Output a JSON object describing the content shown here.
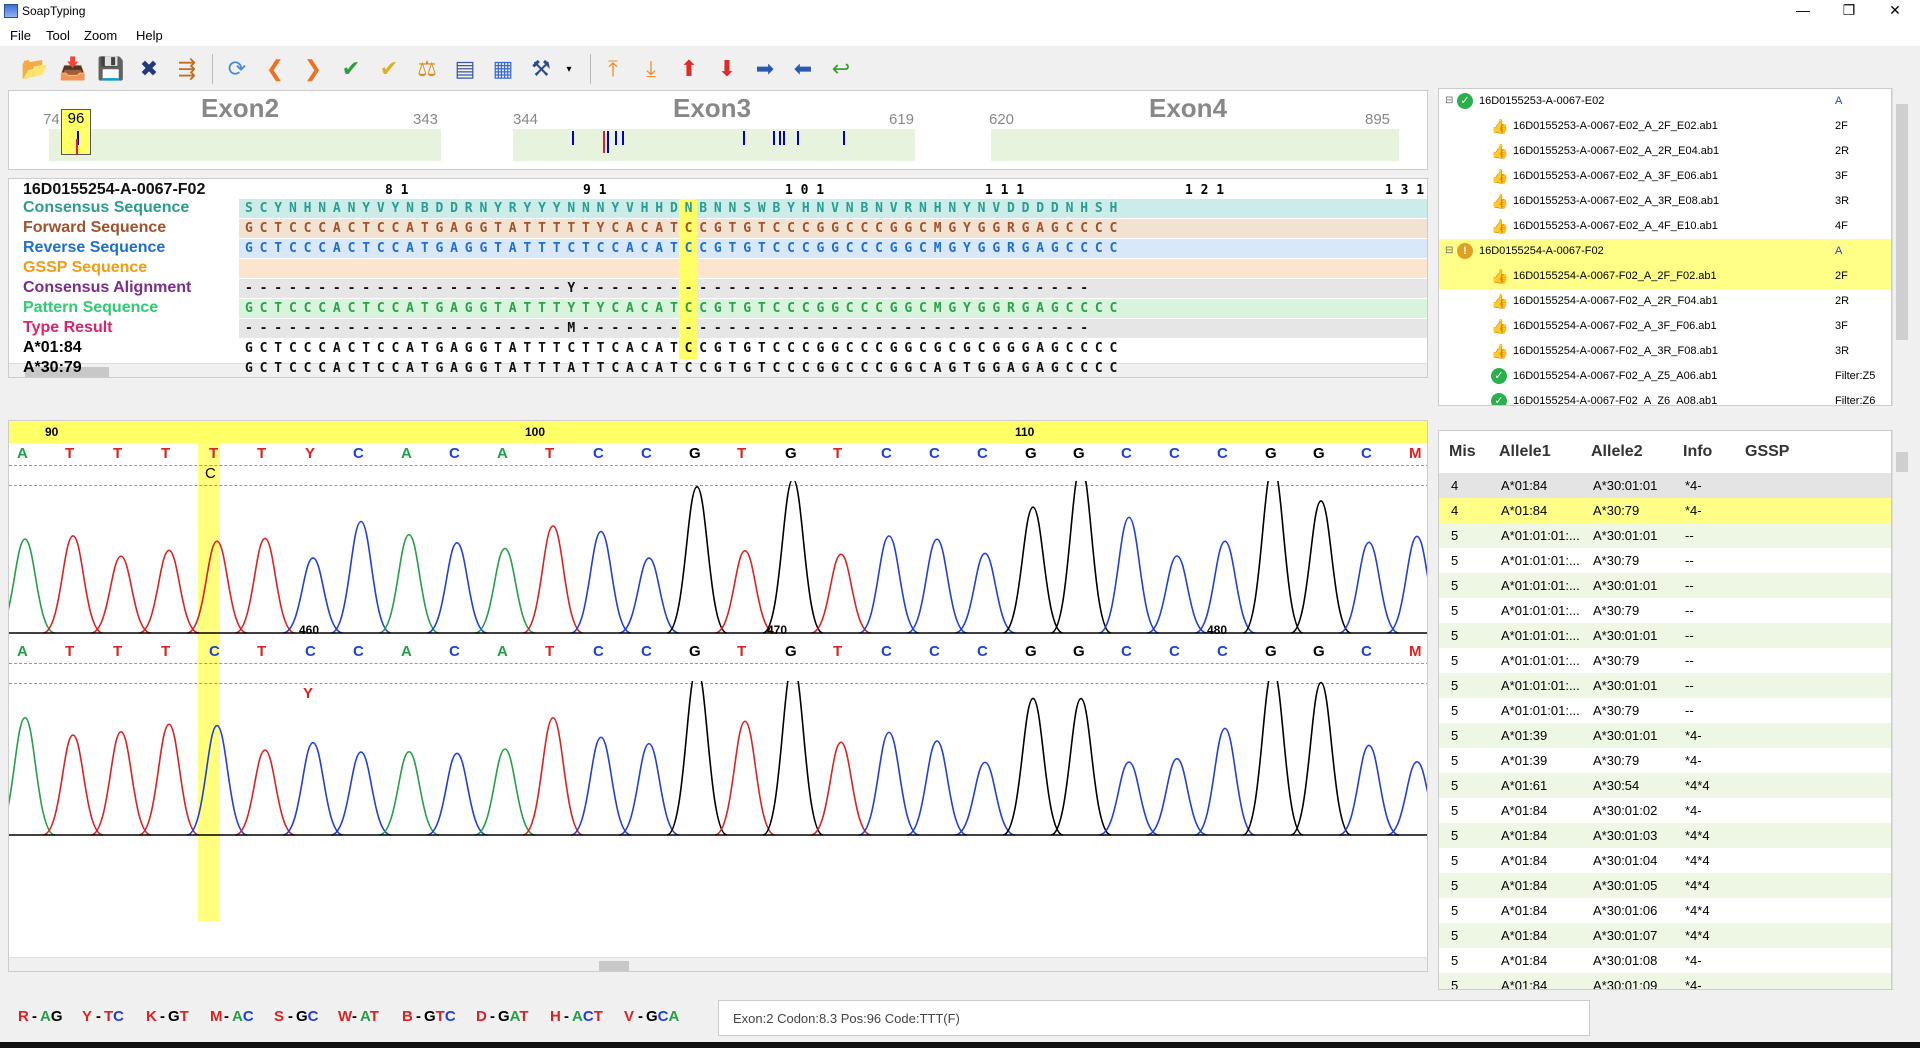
{
  "window": {
    "title": "SoapTyping",
    "minimize": "—",
    "restore": "❐",
    "close": "✕"
  },
  "menu": [
    "File",
    "Tool",
    "Zoom",
    "Help"
  ],
  "exon_map": {
    "exons": [
      {
        "label": "Exon2",
        "start": "74",
        "end": "343"
      },
      {
        "label": "Exon3",
        "start": "344",
        "end": "619"
      },
      {
        "label": "Exon4",
        "start": "620",
        "end": "895"
      }
    ],
    "position_marker": "96"
  },
  "seq_table": {
    "sample_id": "16D0155254-A-0067-F02",
    "codon_numbers": [
      "8 1",
      "9 1",
      "1 0 1",
      "1 1 1",
      "1 2 1",
      "1 3 1"
    ],
    "rows": [
      {
        "label": "Consensus Sequence",
        "color": "#2a9d8f",
        "seq": "S C Y N H N A N Y V Y N B D D R N Y R Y Y Y N N N Y V H H D N B N N S W B Y H N V N B N V R N H N Y N V D D D D N H S H"
      },
      {
        "label": "Forward Sequence",
        "color": "#a0522d",
        "seq": "G C T C C C A C T C C A T G A G G T A T T T T T Y C A C A T C C G T G T C C C G G C C C G G C M G Y G G R G A G C C C C"
      },
      {
        "label": "Reverse Sequence",
        "color": "#1e6fd0",
        "seq": "G C T C C C A C T C C A T G A G G T A T T T C T C C A C A T C C G T G T C C C G G C C C G G C M G Y G G R G A G C C C C"
      },
      {
        "label": "GSSP Sequence",
        "color": "#f39c12",
        "seq": ""
      },
      {
        "label": "Consensus Alignment",
        "color": "#7b2d8e",
        "seq": "- - - - - - - - - - - - - - - - - - - - - - Y - - - - - - - - - - - - - - - - - - - - - - - - - - - - - - - - - - -"
      },
      {
        "label": "Pattern Sequence",
        "color": "#2ecc71",
        "seq": "G C T C C C A C T C C A T G A G G T A T T T Y T Y C A C A T C C G T G T C C C G G C C C G G C M G Y G G R G A G C C C C"
      },
      {
        "label": "Type Result",
        "color": "#e0226b",
        "seq": "- - - - - - - - - - - - - - - - - - - - - - M - - - - - - - - - - - - - - - - - - - - - - - - - - - - - - - - - - -"
      },
      {
        "label": "A*01:84",
        "color": "#000000",
        "seq": "G C T C C C A C T C C A T G A G G T A T T T C T T C A C A T C C G T G T C C C G G C C C G G C G C G C G G G A G C C C C"
      },
      {
        "label": "A*30:79",
        "color": "#000000",
        "seq": "G C T C C C A C T C C A T G A G G T A T T T A T T C A C A T C C G T G T C C C G G C C C G G C A G T G G A G A G C C C C"
      }
    ]
  },
  "chromatogram": {
    "forward": {
      "ruler": [
        "90",
        "100",
        "110"
      ],
      "bases": [
        "A",
        "T",
        "T",
        "T",
        "T",
        "T",
        "Y",
        "C",
        "A",
        "C",
        "A",
        "T",
        "C",
        "C",
        "G",
        "T",
        "G",
        "T",
        "C",
        "C",
        "C",
        "G",
        "G",
        "C",
        "C",
        "C",
        "G",
        "G",
        "C",
        "M"
      ],
      "alt_base": "C"
    },
    "reverse": {
      "ruler": [
        "460",
        "470",
        "480"
      ],
      "bases": [
        "A",
        "T",
        "T",
        "T",
        "C",
        "T",
        "C",
        "C",
        "A",
        "C",
        "A",
        "T",
        "C",
        "C",
        "G",
        "T",
        "G",
        "T",
        "C",
        "C",
        "C",
        "G",
        "G",
        "C",
        "C",
        "C",
        "G",
        "G",
        "C",
        "M"
      ],
      "alt_base": "Y"
    }
  },
  "tree": [
    {
      "name": "16D0155253-A-0067-E02",
      "tag": "A",
      "level": 0,
      "icon": "check-icon",
      "selected": false
    },
    {
      "name": "16D0155253-A-0067-E02_A_2F_E02.ab1",
      "tag": "2F",
      "level": 1,
      "icon": "thumb-icon",
      "selected": false
    },
    {
      "name": "16D0155253-A-0067-E02_A_2R_E04.ab1",
      "tag": "2R",
      "level": 1,
      "icon": "thumb-icon",
      "selected": false
    },
    {
      "name": "16D0155253-A-0067-E02_A_3F_E06.ab1",
      "tag": "3F",
      "level": 1,
      "icon": "thumb-icon",
      "selected": false
    },
    {
      "name": "16D0155253-A-0067-E02_A_3R_E08.ab1",
      "tag": "3R",
      "level": 1,
      "icon": "thumb-icon",
      "selected": false
    },
    {
      "name": "16D0155253-A-0067-E02_A_4F_E10.ab1",
      "tag": "4F",
      "level": 1,
      "icon": "thumb-icon",
      "selected": false
    },
    {
      "name": "16D0155254-A-0067-F02",
      "tag": "A",
      "level": 0,
      "icon": "warning-icon",
      "selected": true
    },
    {
      "name": "16D0155254-A-0067-F02_A_2F_F02.ab1",
      "tag": "2F",
      "level": 1,
      "icon": "thumb-icon",
      "selected": true
    },
    {
      "name": "16D0155254-A-0067-F02_A_2R_F04.ab1",
      "tag": "2R",
      "level": 1,
      "icon": "thumb-icon",
      "selected": false
    },
    {
      "name": "16D0155254-A-0067-F02_A_3F_F06.ab1",
      "tag": "3F",
      "level": 1,
      "icon": "thumb-icon",
      "selected": false
    },
    {
      "name": "16D0155254-A-0067-F02_A_3R_F08.ab1",
      "tag": "3R",
      "level": 1,
      "icon": "thumb-icon",
      "selected": false
    },
    {
      "name": "16D0155254-A-0067-F02_A_Z5_A06.ab1",
      "tag": "Filter:Z5",
      "level": 1,
      "icon": "check-icon",
      "selected": false
    },
    {
      "name": "16D0155254-A-0067-F02_A_Z6_A08.ab1",
      "tag": "Filter:Z6",
      "level": 1,
      "icon": "check-icon",
      "selected": false
    }
  ],
  "result_grid": {
    "headers": [
      "Mis",
      "Allele1",
      "Allele2",
      "Info",
      "GSSP"
    ],
    "rows": [
      [
        "4",
        "A*01:84",
        "A*30:01:01",
        "*4-",
        ""
      ],
      [
        "4",
        "A*01:84",
        "A*30:79",
        "*4-",
        ""
      ],
      [
        "5",
        "A*01:01:01:...",
        "A*30:01:01",
        "--",
        ""
      ],
      [
        "5",
        "A*01:01:01:...",
        "A*30:79",
        "--",
        ""
      ],
      [
        "5",
        "A*01:01:01:...",
        "A*30:01:01",
        "--",
        ""
      ],
      [
        "5",
        "A*01:01:01:...",
        "A*30:79",
        "--",
        ""
      ],
      [
        "5",
        "A*01:01:01:...",
        "A*30:01:01",
        "--",
        ""
      ],
      [
        "5",
        "A*01:01:01:...",
        "A*30:79",
        "--",
        ""
      ],
      [
        "5",
        "A*01:01:01:...",
        "A*30:01:01",
        "--",
        ""
      ],
      [
        "5",
        "A*01:01:01:...",
        "A*30:79",
        "--",
        ""
      ],
      [
        "5",
        "A*01:39",
        "A*30:01:01",
        "*4-",
        ""
      ],
      [
        "5",
        "A*01:39",
        "A*30:79",
        "*4-",
        ""
      ],
      [
        "5",
        "A*01:61",
        "A*30:54",
        "*4*4",
        ""
      ],
      [
        "5",
        "A*01:84",
        "A*30:01:02",
        "*4-",
        ""
      ],
      [
        "5",
        "A*01:84",
        "A*30:01:03",
        "*4*4",
        ""
      ],
      [
        "5",
        "A*01:84",
        "A*30:01:04",
        "*4*4",
        ""
      ],
      [
        "5",
        "A*01:84",
        "A*30:01:05",
        "*4*4",
        ""
      ],
      [
        "5",
        "A*01:84",
        "A*30:01:06",
        "*4*4",
        ""
      ],
      [
        "5",
        "A*01:84",
        "A*30:01:07",
        "*4*4",
        ""
      ],
      [
        "5",
        "A*01:84",
        "A*30:01:08",
        "*4-",
        ""
      ],
      [
        "5",
        "A*01:84",
        "A*30:01:09",
        "*4-",
        ""
      ]
    ],
    "selected_row": 1
  },
  "legend": [
    {
      "code": "R",
      "bases": "AG"
    },
    {
      "code": "Y",
      "bases": "TC"
    },
    {
      "code": "K",
      "bases": "GT"
    },
    {
      "code": "M",
      "bases": "AC"
    },
    {
      "code": "S",
      "bases": "GC"
    },
    {
      "code": "W",
      "bases": "AT"
    },
    {
      "code": "B",
      "bases": "GTC"
    },
    {
      "code": "D",
      "bases": "GAT"
    },
    {
      "code": "H",
      "bases": "ACT"
    },
    {
      "code": "V",
      "bases": "GCA"
    }
  ],
  "status_text": "Exon:2 Codon:8.3 Pos:96 Code:TTT(F)",
  "colors": {
    "A": "#22a045",
    "T": "#e02020",
    "C": "#1f3fe0",
    "G": "#000000",
    "highlight": "#ffff66",
    "grid_alt": "#eef6e4"
  }
}
